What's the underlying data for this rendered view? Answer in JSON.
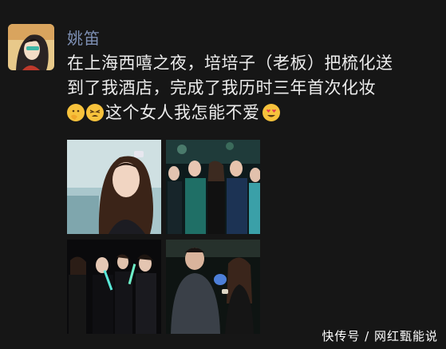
{
  "post": {
    "username": "姚笛",
    "text_line1": "在上海西嘻之夜，培培子（老板）把梳化送",
    "text_line2": "到了我酒店，完成了我历时三年首次化妆",
    "text_line3": "这个女人我怎能不爱",
    "emojis": [
      "thinking-hand-face-icon",
      "tired-face-icon",
      "heart-eyes-face-icon"
    ]
  },
  "photos": [
    {
      "name": "woman-with-hair-clip-photo"
    },
    {
      "name": "group-at-party-photo"
    },
    {
      "name": "group-with-lightsticks-photo"
    },
    {
      "name": "man-and-woman-photo"
    }
  ],
  "watermark": "快传号 / 网红甄能说",
  "colors": {
    "background": "#161616",
    "username": "#7d8fb3",
    "text": "#ececec"
  }
}
